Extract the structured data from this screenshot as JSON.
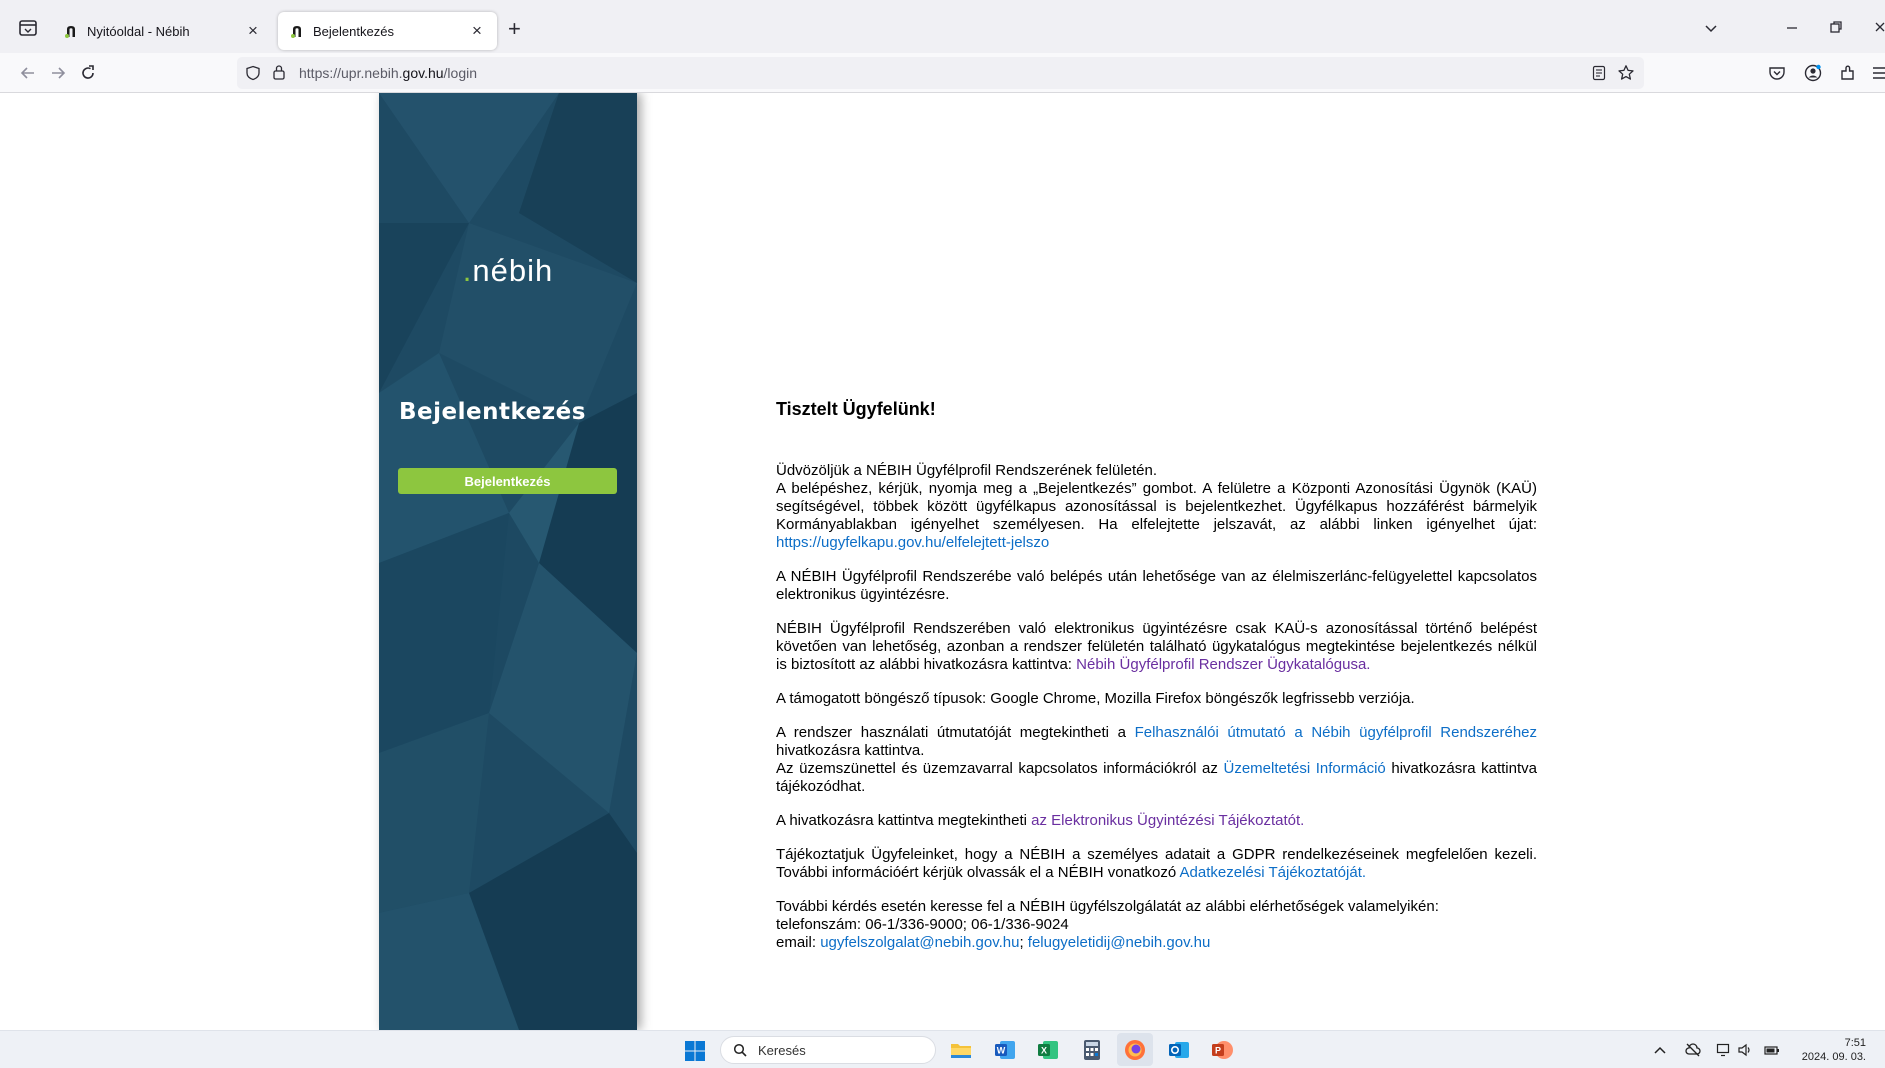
{
  "browser": {
    "tabs": [
      {
        "title": "Nyitóoldal - Nébih",
        "active": false
      },
      {
        "title": "Bejelentkezés",
        "active": true
      }
    ],
    "url_prefix": "https://upr.nebih.",
    "url_domain": "gov.hu",
    "url_path": "/login"
  },
  "sidebar": {
    "logo_dot": ".",
    "logo_text": "nébih",
    "heading": "Bejelentkezés",
    "login_button": "Bejelentkezés",
    "colors": {
      "background": "#1e4a63",
      "accent": "#8dc63f"
    }
  },
  "content": {
    "greeting": "Tisztelt Ügyfelünk!",
    "p1": {
      "l1": "Üdvözöljük a NÉBIH Ügyfélprofil Rendszerének felületén.",
      "l2": "A belépéshez, kérjük, nyomja meg a „Bejelentkezés” gombot. A felületre a Központi Azonosítási Ügynök (KAÜ) segítségével, többek között ügyfélkapus azonosítással is bejelentkezhet. Ügyfélkapus hozzáférést bármelyik Kormányablakban igényelhet személyesen. Ha elfelejtette jelszavát, az alábbi linken igényelhet újat:",
      "link": "https://ugyfelkapu.gov.hu/elfelejtett-jelszo"
    },
    "p2": "A NÉBIH Ügyfélprofil Rendszerébe való belépés után lehetősége van az élelmiszerlánc-felügyelettel kapcsolatos elektronikus ügyintézésre.",
    "p3": {
      "text": "NÉBIH Ügyfélprofil Rendszerében való elektronikus ügyintézésre csak KAÜ-s azonosítással történő belépést követően van lehetőség, azonban a rendszer felületén található ügykatalógus megtekintése bejelentkezés nélkül is biztosított az alábbi hivatkozásra kattintva:",
      "link": "Nébih Ügyfélprofil Rendszer Ügykatalógusa."
    },
    "p4": "A támogatott böngésző típusok: Google Chrome, Mozilla Firefox böngészők legfrissebb verziója.",
    "p5": {
      "pre1": "A rendszer használati útmutatóját megtekintheti a",
      "link1": "Felhasználói útmutató a Nébih ügyfélprofil Rendszeréhez",
      "post1": "hivatkozásra kattintva.",
      "pre2": "Az üzemszünettel és üzemzavarral kapcsolatos információkról az",
      "link2": "Üzemeltetési Információ",
      "post2": "hivatkozásra kattintva tájékozódhat."
    },
    "p6": {
      "pre": "A hivatkozásra kattintva megtekintheti",
      "link": "az Elektronikus Ügyintézési Tájékoztatót."
    },
    "p7": {
      "text": "Tájékoztatjuk Ügyfeleinket, hogy a NÉBIH a személyes adatait a GDPR rendelkezéseinek megfelelően kezeli. További információért kérjük olvassák el a NÉBIH vonatkozó",
      "link": "Adatkezelési Tájékoztatóját."
    },
    "p8": {
      "l1": "További kérdés esetén keresse fel a NÉBIH ügyfélszolgálatát az alábbi elérhetőségek valamelyikén:",
      "l2": "telefonszám: 06-1/336-9000; 06-1/336-9024",
      "email_label": "email:",
      "email1": "ugyfelszolgalat@nebih.gov.hu",
      "sep": ";",
      "email2": "felugyeletidij@nebih.gov.hu"
    }
  },
  "taskbar": {
    "search_placeholder": "Keresés",
    "time": "7:51",
    "date": "2024. 09. 03."
  }
}
